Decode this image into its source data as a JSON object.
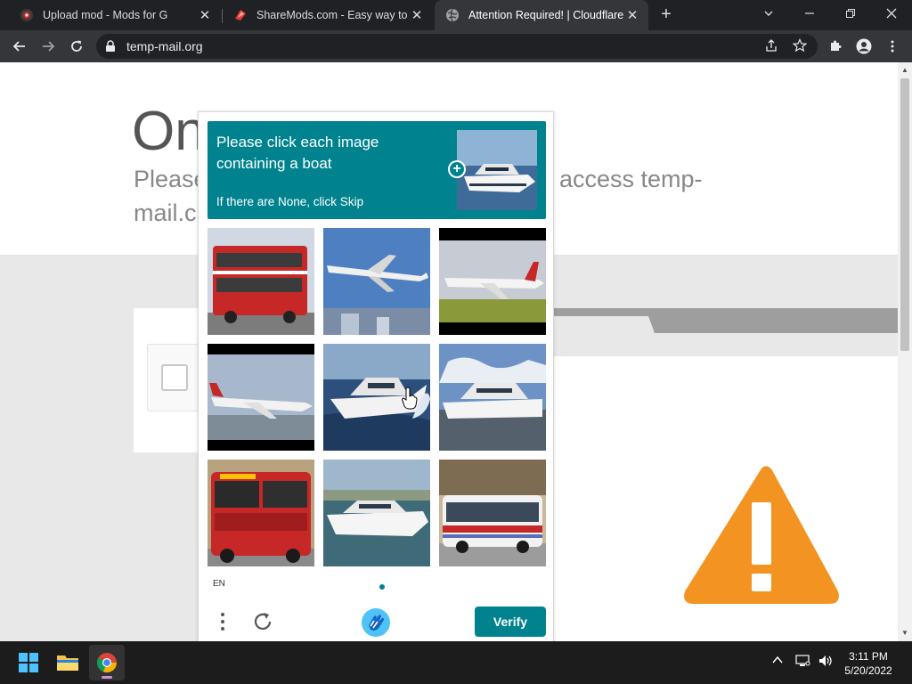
{
  "browser": {
    "tabs": [
      {
        "title": "Upload mod - Mods for G",
        "active": false,
        "icon": "gta-mods-icon"
      },
      {
        "title": "ShareMods.com - Easy way to sh",
        "active": false,
        "icon": "sharemods-icon"
      },
      {
        "title": "Attention Required! | Cloudflare",
        "active": true,
        "icon": "globe-icon"
      }
    ],
    "url": "temp-mail.org"
  },
  "page": {
    "heading": "On",
    "subtitle_left_line1": "Please",
    "subtitle_left_line2": "mail.c",
    "subtitle_right": "access temp-",
    "warning_color": "#f29322"
  },
  "captcha": {
    "prompt": "Please click each image containing a boat",
    "hint": "If there are None, click Skip",
    "language": "EN",
    "verify_label": "Verify",
    "accent_color": "#00838f",
    "tiles": [
      {
        "subject": "double-decker bus"
      },
      {
        "subject": "airplane"
      },
      {
        "subject": "airplane"
      },
      {
        "subject": "airplane"
      },
      {
        "subject": "boat"
      },
      {
        "subject": "boat"
      },
      {
        "subject": "bus"
      },
      {
        "subject": "boat"
      },
      {
        "subject": "bus"
      }
    ]
  },
  "taskbar": {
    "apps": [
      "windows-start-icon",
      "file-explorer-icon",
      "chrome-icon"
    ],
    "time": "3:11 PM",
    "date": "5/20/2022"
  }
}
